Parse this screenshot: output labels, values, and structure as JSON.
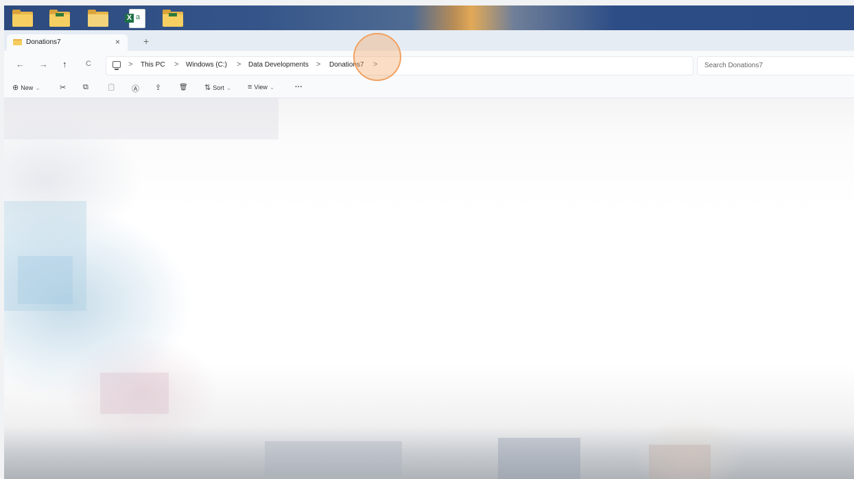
{
  "desktop": {
    "icons": [
      {
        "name": "folder",
        "kind": "folder"
      },
      {
        "name": "folder",
        "kind": "folder"
      },
      {
        "name": "folder",
        "kind": "folder"
      },
      {
        "name": "excel-file",
        "kind": "excel",
        "badge": "X",
        "letter": "a"
      },
      {
        "name": "folder",
        "kind": "folder"
      }
    ]
  },
  "tabs": {
    "active_label": "Donations7",
    "close_glyph": "×",
    "new_tab_glyph": "+"
  },
  "nav": {
    "back": "←",
    "forward": "→",
    "up": "↑",
    "refresh": "C"
  },
  "breadcrumb": {
    "sep": ">",
    "items": [
      "This PC",
      "Windows (C:)",
      "Data Developments",
      "Donations7"
    ]
  },
  "search": {
    "placeholder": "Search Donations7"
  },
  "toolbar": {
    "new_label": "New",
    "sort_label": "Sort",
    "view_label": "View",
    "more_label": "···",
    "cut_glyph": "✂",
    "copy_glyph": "⧉",
    "paste_glyph": "📋",
    "rename_glyph": "Ⓐ",
    "share_glyph": "⇪",
    "delete_glyph": "🗑",
    "sort_glyph": "⇅",
    "view_glyph": "≡",
    "new_glyph": "⊕",
    "dropdown_glyph": "⌄"
  },
  "colors": {
    "accent_folder": "#f6cf62",
    "click_highlight": "#f1a161",
    "excel_green": "#1d7044"
  }
}
